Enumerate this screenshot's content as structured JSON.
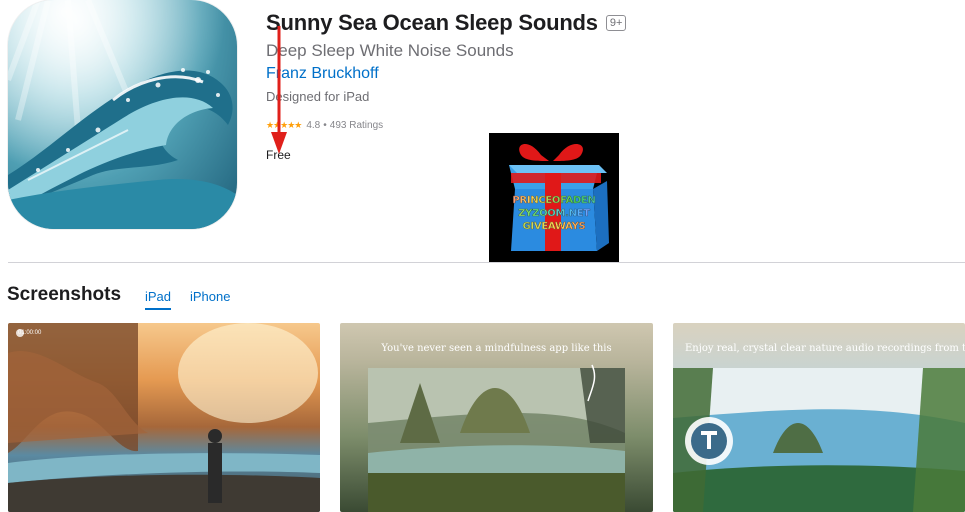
{
  "app": {
    "title": "Sunny Sea Ocean Sleep Sounds",
    "age_rating": "9+",
    "subtitle": "Deep Sleep White Noise Sounds",
    "developer": "Franz Bruckhoff",
    "designed_for": "Designed for iPad",
    "rating": {
      "stars": "★★★★★",
      "score": "4.8",
      "separator": "•",
      "count": "493 Ratings"
    },
    "price": "Free"
  },
  "giveaway": {
    "line1": "PRINCEOFADEN",
    "line2": "ZYZOOM.NET",
    "line3": "GIVEAWAYS"
  },
  "screenshots": {
    "heading": "Screenshots",
    "tabs": [
      "iPad",
      "iPhone"
    ],
    "selected_tab": "iPad",
    "items": [
      {
        "caption": "",
        "timer": "01:00:00"
      },
      {
        "caption": "You've never seen a mindfulness app like this"
      },
      {
        "caption": "Enjoy real, crystal clear nature audio recordings from the s"
      }
    ]
  },
  "colors": {
    "link": "#0070c9",
    "star": "#ff9f0a",
    "annotation_arrow": "#e0201b"
  }
}
